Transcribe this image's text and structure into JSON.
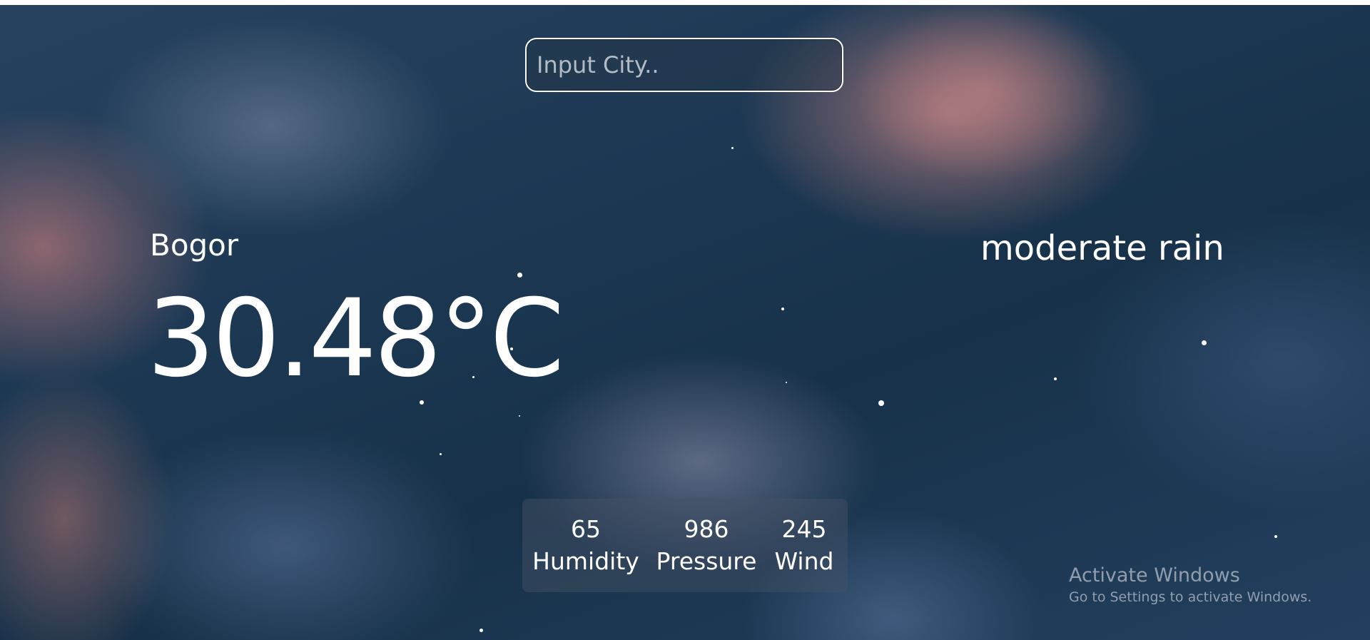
{
  "search": {
    "placeholder": "Input City..",
    "value": ""
  },
  "weather": {
    "city": "Bogor",
    "temperature": "30.48°C",
    "description": "moderate rain"
  },
  "stats": {
    "humidity": {
      "value": "65",
      "label": "Humidity"
    },
    "pressure": {
      "value": "986",
      "label": "Pressure"
    },
    "wind": {
      "value": "245",
      "label": "Wind"
    }
  },
  "watermark": {
    "title": "Activate Windows",
    "subtitle": "Go to Settings to activate Windows."
  },
  "colors": {
    "text": "#ffffff",
    "sky_dark": "#173149",
    "cloud_pink": "#c48484"
  }
}
